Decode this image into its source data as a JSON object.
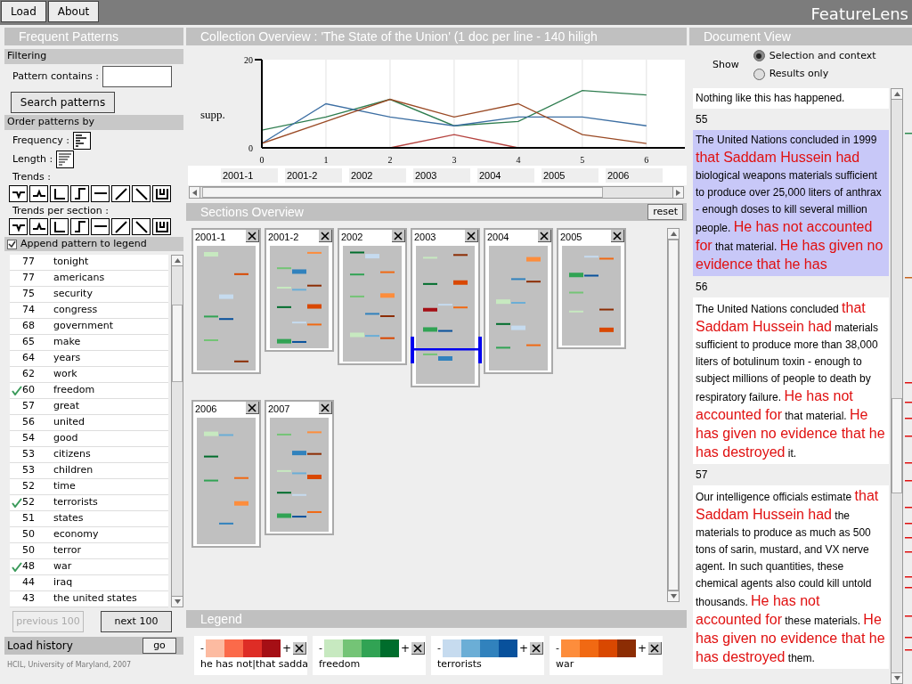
{
  "toolbar": {
    "buttons": [
      "Load",
      "About"
    ],
    "app_title": "FeatureLens"
  },
  "patterns_panel": {
    "title": "Frequent Patterns",
    "filtering": {
      "header": "Filtering",
      "label": "Pattern contains :",
      "search_button": "Search patterns"
    },
    "order": {
      "header": "Order patterns by",
      "frequency_label": "Frequency :",
      "length_label": "Length :",
      "trends_label": "Trends :",
      "trends_per_section_label": "Trends per section :"
    },
    "append": {
      "label": "Append pattern to legend",
      "checked": true
    },
    "patterns": [
      {
        "count": "77",
        "text": "tonight",
        "checked": false
      },
      {
        "count": "77",
        "text": "americans",
        "checked": false
      },
      {
        "count": "75",
        "text": "security",
        "checked": false
      },
      {
        "count": "74",
        "text": "congress",
        "checked": false
      },
      {
        "count": "68",
        "text": "government",
        "checked": false
      },
      {
        "count": "65",
        "text": "make",
        "checked": false
      },
      {
        "count": "64",
        "text": "years",
        "checked": false
      },
      {
        "count": "62",
        "text": "work",
        "checked": false
      },
      {
        "count": "60",
        "text": "freedom",
        "checked": true
      },
      {
        "count": "57",
        "text": "great",
        "checked": false
      },
      {
        "count": "56",
        "text": "united",
        "checked": false
      },
      {
        "count": "54",
        "text": "good",
        "checked": false
      },
      {
        "count": "53",
        "text": "citizens",
        "checked": false
      },
      {
        "count": "53",
        "text": "children",
        "checked": false
      },
      {
        "count": "52",
        "text": "time",
        "checked": false
      },
      {
        "count": "52",
        "text": "terrorists",
        "checked": true
      },
      {
        "count": "51",
        "text": "states",
        "checked": false
      },
      {
        "count": "50",
        "text": "economy",
        "checked": false
      },
      {
        "count": "50",
        "text": "terror",
        "checked": false
      },
      {
        "count": "48",
        "text": "war",
        "checked": true
      },
      {
        "count": "44",
        "text": "iraq",
        "checked": false
      },
      {
        "count": "43",
        "text": "the united states",
        "checked": false
      }
    ],
    "previous_button": {
      "label": "previous 100",
      "disabled": true
    },
    "next_button": {
      "label": "next 100",
      "disabled": false
    },
    "history": {
      "label": "Load history",
      "button": "go"
    },
    "credit": "HCIL, University of Maryland, 2007"
  },
  "collection_overview": {
    "title": "Collection Overview : 'The State of the Union' (1 doc per line - 140 hiligh",
    "chart_data": {
      "type": "line",
      "ylabel": "supp.",
      "x": [
        0,
        1,
        2,
        3,
        4,
        5,
        6
      ],
      "xlim": [
        0,
        6.6
      ],
      "ylim": [
        0,
        20
      ],
      "xticks": [
        0,
        1,
        2,
        3,
        4,
        5,
        6
      ],
      "yticks": [
        0,
        20
      ],
      "grid": true,
      "series": [
        {
          "color": "#b5433f",
          "values": [
            null,
            null,
            0,
            3,
            0,
            null,
            null
          ]
        },
        {
          "color": "#2e7d4f",
          "values": [
            4,
            7,
            11,
            5,
            6,
            13,
            12
          ]
        },
        {
          "color": "#3d6fa3",
          "values": [
            1,
            10,
            7,
            5,
            7,
            7,
            5
          ]
        },
        {
          "color": "#9a4a25",
          "values": [
            1,
            6,
            11,
            7,
            10,
            3,
            1
          ]
        }
      ]
    },
    "section_labels": [
      "2001-1",
      "2001-2",
      "2002",
      "2003",
      "2004",
      "2005",
      "2006"
    ]
  },
  "sections_overview": {
    "title": "Sections Overview",
    "reset_button": "reset",
    "sections": [
      {
        "label": "2001-1"
      },
      {
        "label": "2001-2"
      },
      {
        "label": "2002"
      },
      {
        "label": "2003"
      },
      {
        "label": "2004"
      },
      {
        "label": "2005"
      },
      {
        "label": "2006"
      },
      {
        "label": "2007"
      }
    ]
  },
  "legend": {
    "title": "Legend",
    "items": [
      {
        "label": "he has not|that sadda",
        "minus": "-",
        "plus": "+",
        "swatches": [
          {
            "color": "#fcbba1"
          },
          {
            "color": "#fb6a4a"
          },
          {
            "color": "#de2d26"
          },
          {
            "color": "#a50f15"
          }
        ]
      },
      {
        "label": "freedom",
        "minus": "-",
        "plus": "+",
        "swatches": [
          {
            "color": "#c7e9c0"
          },
          {
            "color": "#74c476"
          },
          {
            "color": "#31a354"
          },
          {
            "color": "#006d2c"
          }
        ]
      },
      {
        "label": "terrorists",
        "minus": "-",
        "plus": "+",
        "swatches": [
          {
            "color": "#c6dbef"
          },
          {
            "color": "#6baed6"
          },
          {
            "color": "#3182bd"
          },
          {
            "color": "#08519c"
          }
        ]
      },
      {
        "label": "war",
        "minus": "-",
        "plus": "+",
        "swatches": [
          {
            "color": "#fd8d3c"
          },
          {
            "color": "#f16913"
          },
          {
            "color": "#d94801"
          },
          {
            "color": "#8c2d04"
          }
        ]
      }
    ]
  },
  "document_view": {
    "title": "Document View",
    "show_label": "Show",
    "options": [
      {
        "label": "Selection and context",
        "selected": true
      },
      {
        "label": "Results only",
        "selected": false
      }
    ],
    "paragraphs": [
      {
        "selected": false,
        "segments": [
          {
            "text": "Nothing like this has happened.",
            "highlight": false
          }
        ]
      },
      {
        "number": "55",
        "selected": true,
        "segments": [
          {
            "text": "The United Nations concluded in 1999 ",
            "highlight": false
          },
          {
            "text": "that Saddam Hussein had",
            "highlight": true
          },
          {
            "text": " biological weapons materials sufficient to produce over 25,000 liters of anthrax - enough doses to kill several million people. ",
            "highlight": false
          },
          {
            "text": "He has not accounted for",
            "highlight": true
          },
          {
            "text": " that material. ",
            "highlight": false
          },
          {
            "text": "He has given no evidence that he has",
            "highlight": true
          }
        ]
      },
      {
        "number": "56",
        "selected": false,
        "segments": [
          {
            "text": "The United Nations concluded ",
            "highlight": false
          },
          {
            "text": "that Saddam Hussein had",
            "highlight": true
          },
          {
            "text": " materials sufficient to produce more than 38,000 liters of botulinum toxin - enough to subject millions of people to death by respiratory failure. ",
            "highlight": false
          },
          {
            "text": "He has not accounted for",
            "highlight": true
          },
          {
            "text": " that material. ",
            "highlight": false
          },
          {
            "text": "He has given no evidence that he has destroyed",
            "highlight": true
          },
          {
            "text": " it.",
            "highlight": false
          }
        ]
      },
      {
        "number": "57",
        "selected": false,
        "segments": [
          {
            "text": "Our intelligence officials estimate ",
            "highlight": false
          },
          {
            "text": "that Saddam Hussein had",
            "highlight": true
          },
          {
            "text": " the materials to produce as much as 500 tons of sarin, mustard, and VX nerve agent. In such quantities, these chemical agents also could kill untold thousands. ",
            "highlight": false
          },
          {
            "text": "He has not accounted for",
            "highlight": true
          },
          {
            "text": " these materials. ",
            "highlight": false
          },
          {
            "text": "He has given no evidence that he has destroyed",
            "highlight": true
          },
          {
            "text": " them.",
            "highlight": false
          }
        ]
      }
    ]
  }
}
